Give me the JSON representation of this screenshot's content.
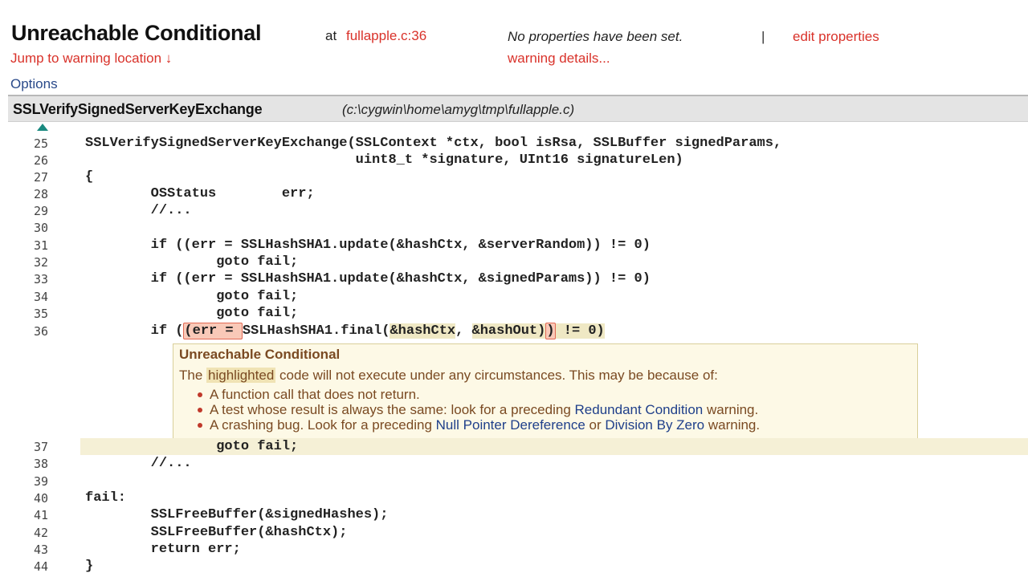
{
  "header": {
    "title": "Unreachable Conditional",
    "at_label": "at",
    "location_link": "fullapple.c:36",
    "jump_link": "Jump to warning location ↓",
    "no_properties": "No properties have been set.",
    "separator": "|",
    "edit_link": "edit properties",
    "details_link": "warning details...",
    "options_link": "Options"
  },
  "function_bar": {
    "name": "SSLVerifySignedServerKeyExchange",
    "path": "(c:\\cygwin\\home\\amyg\\tmp\\fullapple.c)"
  },
  "code": {
    "lines": [
      {
        "num": "25",
        "text": "SSLVerifySignedServerKeyExchange(SSLContext *ctx, bool isRsa, SSLBuffer signedParams,"
      },
      {
        "num": "26",
        "text": "                                 uint8_t *signature, UInt16 signatureLen)"
      },
      {
        "num": "27",
        "text": "{"
      },
      {
        "num": "28",
        "text": "        OSStatus        err;"
      },
      {
        "num": "29",
        "text": "        //..."
      },
      {
        "num": "30",
        "text": ""
      },
      {
        "num": "31",
        "text": "        if ((err = SSLHashSHA1.update(&hashCtx, &serverRandom)) != 0)"
      },
      {
        "num": "32",
        "text": "                goto fail;"
      },
      {
        "num": "33",
        "text": "        if ((err = SSLHashSHA1.update(&hashCtx, &signedParams)) != 0)"
      },
      {
        "num": "34",
        "text": "                goto fail;"
      },
      {
        "num": "35",
        "text": "                goto fail;"
      },
      {
        "num": "36",
        "prefix": "        if (",
        "hl_a": "(err = ",
        "mid": "SSLHashSHA1.final(",
        "hl_b": "&hashCtx",
        "mid2": ", ",
        "hl_c": "&hashOut)",
        "hl_d": ")",
        "suffix": " != 0)"
      },
      {
        "num": "37",
        "text": "                goto fail;"
      },
      {
        "num": "38",
        "text": "        //..."
      },
      {
        "num": "39",
        "text": ""
      },
      {
        "num": "40",
        "text": "fail:"
      },
      {
        "num": "41",
        "text": "        SSLFreeBuffer(&signedHashes);"
      },
      {
        "num": "42",
        "text": "        SSLFreeBuffer(&hashCtx);"
      },
      {
        "num": "43",
        "text": "        return err;"
      },
      {
        "num": "44",
        "text": "}"
      }
    ]
  },
  "popup": {
    "title": "Unreachable Conditional",
    "text_before": "The ",
    "text_highlight": "highlighted",
    "text_after": " code will not execute under any circumstances. This may be because of:",
    "bullets": [
      {
        "a": "A function call that does not return.",
        "link1": "",
        "b": "",
        "link2": "",
        "c": ""
      },
      {
        "a": "A test whose result is always the same: look for a preceding ",
        "link1": "Redundant Condition",
        "b": " warning.",
        "link2": "",
        "c": ""
      },
      {
        "a": "A crashing bug.  Look for a preceding ",
        "link1": "Null Pointer Dereference",
        "b": " or ",
        "link2": "Division By Zero",
        "c": " warning."
      }
    ]
  },
  "colors": {
    "link_red": "#d9322a",
    "link_blue": "#2a4a8a",
    "popup_text": "#7a4a22",
    "row_highlight": "#f5f0d6"
  }
}
